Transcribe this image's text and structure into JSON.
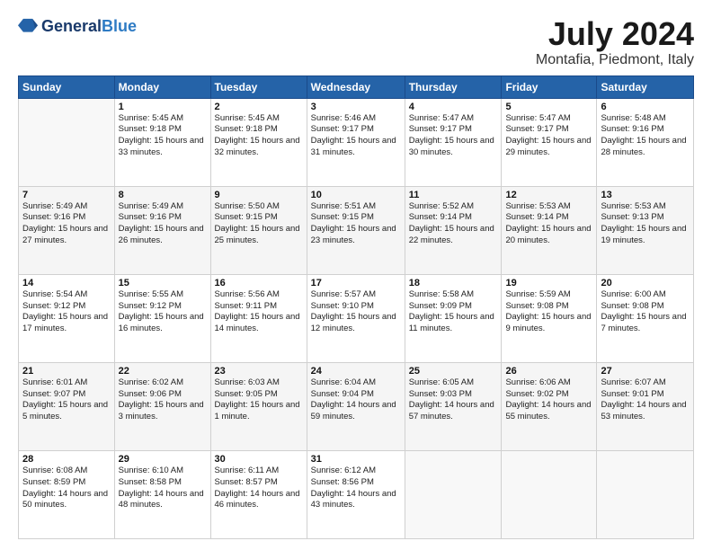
{
  "logo": {
    "general": "General",
    "blue": "Blue"
  },
  "title": "July 2024",
  "location": "Montafia, Piedmont, Italy",
  "days_of_week": [
    "Sunday",
    "Monday",
    "Tuesday",
    "Wednesday",
    "Thursday",
    "Friday",
    "Saturday"
  ],
  "weeks": [
    [
      {
        "num": "",
        "empty": true
      },
      {
        "num": "1",
        "sunrise": "5:45 AM",
        "sunset": "9:18 PM",
        "daylight": "15 hours and 33 minutes."
      },
      {
        "num": "2",
        "sunrise": "5:45 AM",
        "sunset": "9:18 PM",
        "daylight": "15 hours and 32 minutes."
      },
      {
        "num": "3",
        "sunrise": "5:46 AM",
        "sunset": "9:17 PM",
        "daylight": "15 hours and 31 minutes."
      },
      {
        "num": "4",
        "sunrise": "5:47 AM",
        "sunset": "9:17 PM",
        "daylight": "15 hours and 30 minutes."
      },
      {
        "num": "5",
        "sunrise": "5:47 AM",
        "sunset": "9:17 PM",
        "daylight": "15 hours and 29 minutes."
      },
      {
        "num": "6",
        "sunrise": "5:48 AM",
        "sunset": "9:16 PM",
        "daylight": "15 hours and 28 minutes."
      }
    ],
    [
      {
        "num": "7",
        "sunrise": "5:49 AM",
        "sunset": "9:16 PM",
        "daylight": "15 hours and 27 minutes."
      },
      {
        "num": "8",
        "sunrise": "5:49 AM",
        "sunset": "9:16 PM",
        "daylight": "15 hours and 26 minutes."
      },
      {
        "num": "9",
        "sunrise": "5:50 AM",
        "sunset": "9:15 PM",
        "daylight": "15 hours and 25 minutes."
      },
      {
        "num": "10",
        "sunrise": "5:51 AM",
        "sunset": "9:15 PM",
        "daylight": "15 hours and 23 minutes."
      },
      {
        "num": "11",
        "sunrise": "5:52 AM",
        "sunset": "9:14 PM",
        "daylight": "15 hours and 22 minutes."
      },
      {
        "num": "12",
        "sunrise": "5:53 AM",
        "sunset": "9:14 PM",
        "daylight": "15 hours and 20 minutes."
      },
      {
        "num": "13",
        "sunrise": "5:53 AM",
        "sunset": "9:13 PM",
        "daylight": "15 hours and 19 minutes."
      }
    ],
    [
      {
        "num": "14",
        "sunrise": "5:54 AM",
        "sunset": "9:12 PM",
        "daylight": "15 hours and 17 minutes."
      },
      {
        "num": "15",
        "sunrise": "5:55 AM",
        "sunset": "9:12 PM",
        "daylight": "15 hours and 16 minutes."
      },
      {
        "num": "16",
        "sunrise": "5:56 AM",
        "sunset": "9:11 PM",
        "daylight": "15 hours and 14 minutes."
      },
      {
        "num": "17",
        "sunrise": "5:57 AM",
        "sunset": "9:10 PM",
        "daylight": "15 hours and 12 minutes."
      },
      {
        "num": "18",
        "sunrise": "5:58 AM",
        "sunset": "9:09 PM",
        "daylight": "15 hours and 11 minutes."
      },
      {
        "num": "19",
        "sunrise": "5:59 AM",
        "sunset": "9:08 PM",
        "daylight": "15 hours and 9 minutes."
      },
      {
        "num": "20",
        "sunrise": "6:00 AM",
        "sunset": "9:08 PM",
        "daylight": "15 hours and 7 minutes."
      }
    ],
    [
      {
        "num": "21",
        "sunrise": "6:01 AM",
        "sunset": "9:07 PM",
        "daylight": "15 hours and 5 minutes."
      },
      {
        "num": "22",
        "sunrise": "6:02 AM",
        "sunset": "9:06 PM",
        "daylight": "15 hours and 3 minutes."
      },
      {
        "num": "23",
        "sunrise": "6:03 AM",
        "sunset": "9:05 PM",
        "daylight": "15 hours and 1 minute."
      },
      {
        "num": "24",
        "sunrise": "6:04 AM",
        "sunset": "9:04 PM",
        "daylight": "14 hours and 59 minutes."
      },
      {
        "num": "25",
        "sunrise": "6:05 AM",
        "sunset": "9:03 PM",
        "daylight": "14 hours and 57 minutes."
      },
      {
        "num": "26",
        "sunrise": "6:06 AM",
        "sunset": "9:02 PM",
        "daylight": "14 hours and 55 minutes."
      },
      {
        "num": "27",
        "sunrise": "6:07 AM",
        "sunset": "9:01 PM",
        "daylight": "14 hours and 53 minutes."
      }
    ],
    [
      {
        "num": "28",
        "sunrise": "6:08 AM",
        "sunset": "8:59 PM",
        "daylight": "14 hours and 50 minutes."
      },
      {
        "num": "29",
        "sunrise": "6:10 AM",
        "sunset": "8:58 PM",
        "daylight": "14 hours and 48 minutes."
      },
      {
        "num": "30",
        "sunrise": "6:11 AM",
        "sunset": "8:57 PM",
        "daylight": "14 hours and 46 minutes."
      },
      {
        "num": "31",
        "sunrise": "6:12 AM",
        "sunset": "8:56 PM",
        "daylight": "14 hours and 43 minutes."
      },
      {
        "num": "",
        "empty": true
      },
      {
        "num": "",
        "empty": true
      },
      {
        "num": "",
        "empty": true
      }
    ]
  ]
}
